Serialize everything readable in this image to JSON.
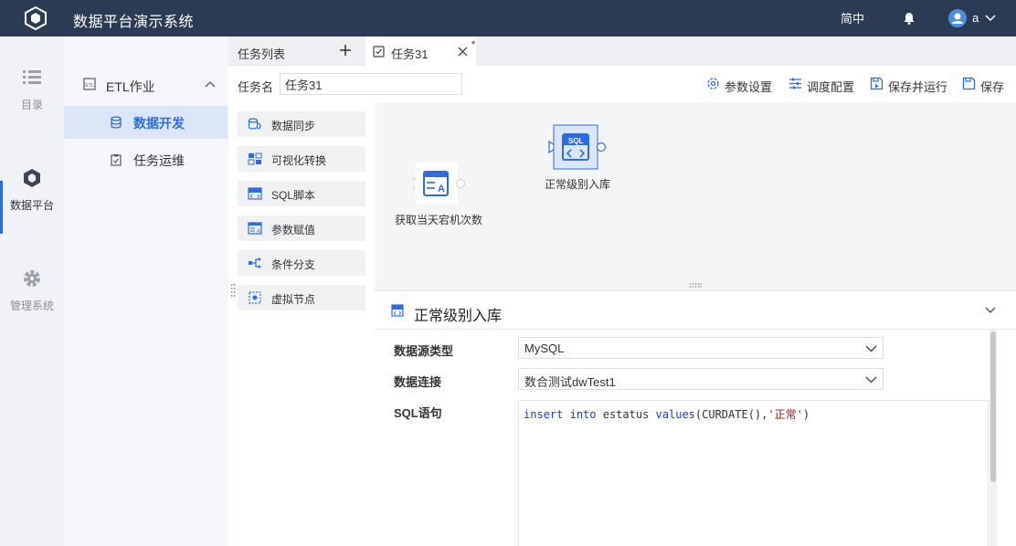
{
  "app": {
    "title": "数据平台演示系统",
    "lang": "简中",
    "user": "a"
  },
  "rail": [
    {
      "label": "目录",
      "icon": "list-icon"
    },
    {
      "label": "数据平台",
      "icon": "cube-icon"
    },
    {
      "label": "管理系统",
      "icon": "gear-icon"
    }
  ],
  "submenu": {
    "group": "ETL作业",
    "items": [
      {
        "label": "数据开发",
        "icon": "database-icon"
      },
      {
        "label": "任务运维",
        "icon": "clipboard-icon"
      }
    ]
  },
  "tabs": {
    "list_label": "任务列表",
    "task_label": "任务31",
    "modified_marker": "*"
  },
  "namebar": {
    "label": "任务名",
    "value": "任务31",
    "tools": [
      "参数设置",
      "调度配置",
      "保存并运行",
      "保存"
    ]
  },
  "palette": [
    "数据同步",
    "可视化转换",
    "SQL脚本",
    "参数赋值",
    "条件分支",
    "虚拟节点"
  ],
  "canvas": {
    "nodes": [
      {
        "label": "获取当天宕机次数",
        "icon": "param-assign-icon"
      },
      {
        "label": "正常级别入库",
        "icon": "sql-icon",
        "icon_text": "SQL"
      }
    ]
  },
  "props": {
    "title": "正常级别入库",
    "fields": [
      {
        "label": "数据源类型",
        "value": "MySQL"
      },
      {
        "label": "数据连接",
        "value": "数合测试dwTest1"
      }
    ],
    "sql_label": "SQL语句",
    "sql": {
      "kw1": "insert",
      "kw2": "into",
      "table": "estatus",
      "kw3": "values",
      "fn": "(CURDATE(),",
      "str": "'正常'",
      "tail": ")"
    }
  },
  "colors": {
    "topbar": "#2b3a55",
    "accent": "#2b6ce4",
    "active_bg": "#dbe7f9"
  }
}
